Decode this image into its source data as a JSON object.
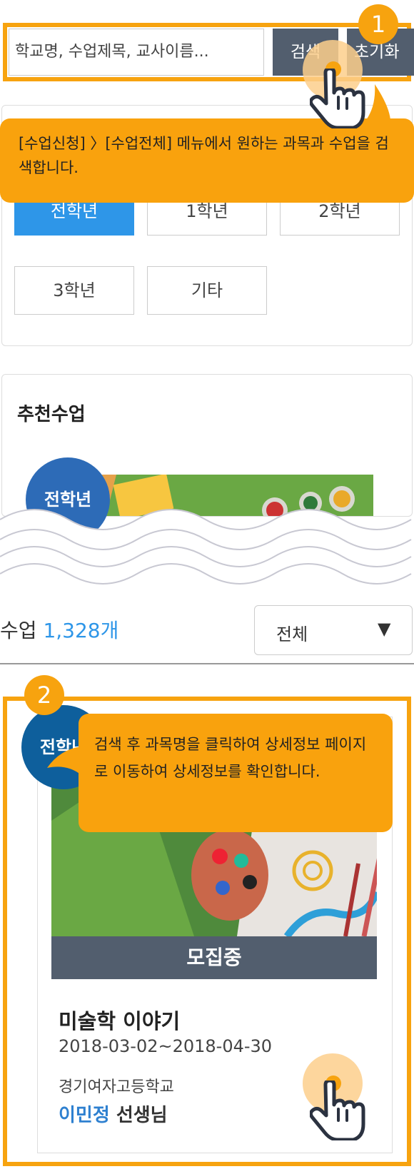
{
  "search": {
    "placeholder": "학교명, 수업제목, 교사이름...",
    "search_button": "검색",
    "reset_button": "초기화"
  },
  "steps": {
    "step1_number": "1",
    "step1_tooltip": "[수업신청] 〉[수업전체] 메뉴에서 원하는 과목과 수업을 검색합니다.",
    "step2_number": "2",
    "step2_tooltip": "검색 후 과목명을 클릭하여 상세정보 페이지로 이동하여 상세정보를 확인합니다."
  },
  "grade_filter": {
    "items": [
      "전학년",
      "1학년",
      "2학년",
      "3학년",
      "기타"
    ],
    "selected": "전학년"
  },
  "recommended": {
    "title": "추천수업",
    "badge": "전학년"
  },
  "results": {
    "label": "수업",
    "count": "1,328개",
    "sort_select": "전체",
    "sort_arrow": "▼"
  },
  "course": {
    "badge": "전학년",
    "status": "모집중",
    "title": "미술학 이야기",
    "date_range": "2018-03-02~2018-04-30",
    "school": "경기여자고등학교",
    "teacher_name": "이민정",
    "teacher_suffix": "선생님"
  },
  "colors": {
    "highlight": "#f7a30f",
    "active_blue": "#2e96e8",
    "dark_button": "#525e6e"
  }
}
